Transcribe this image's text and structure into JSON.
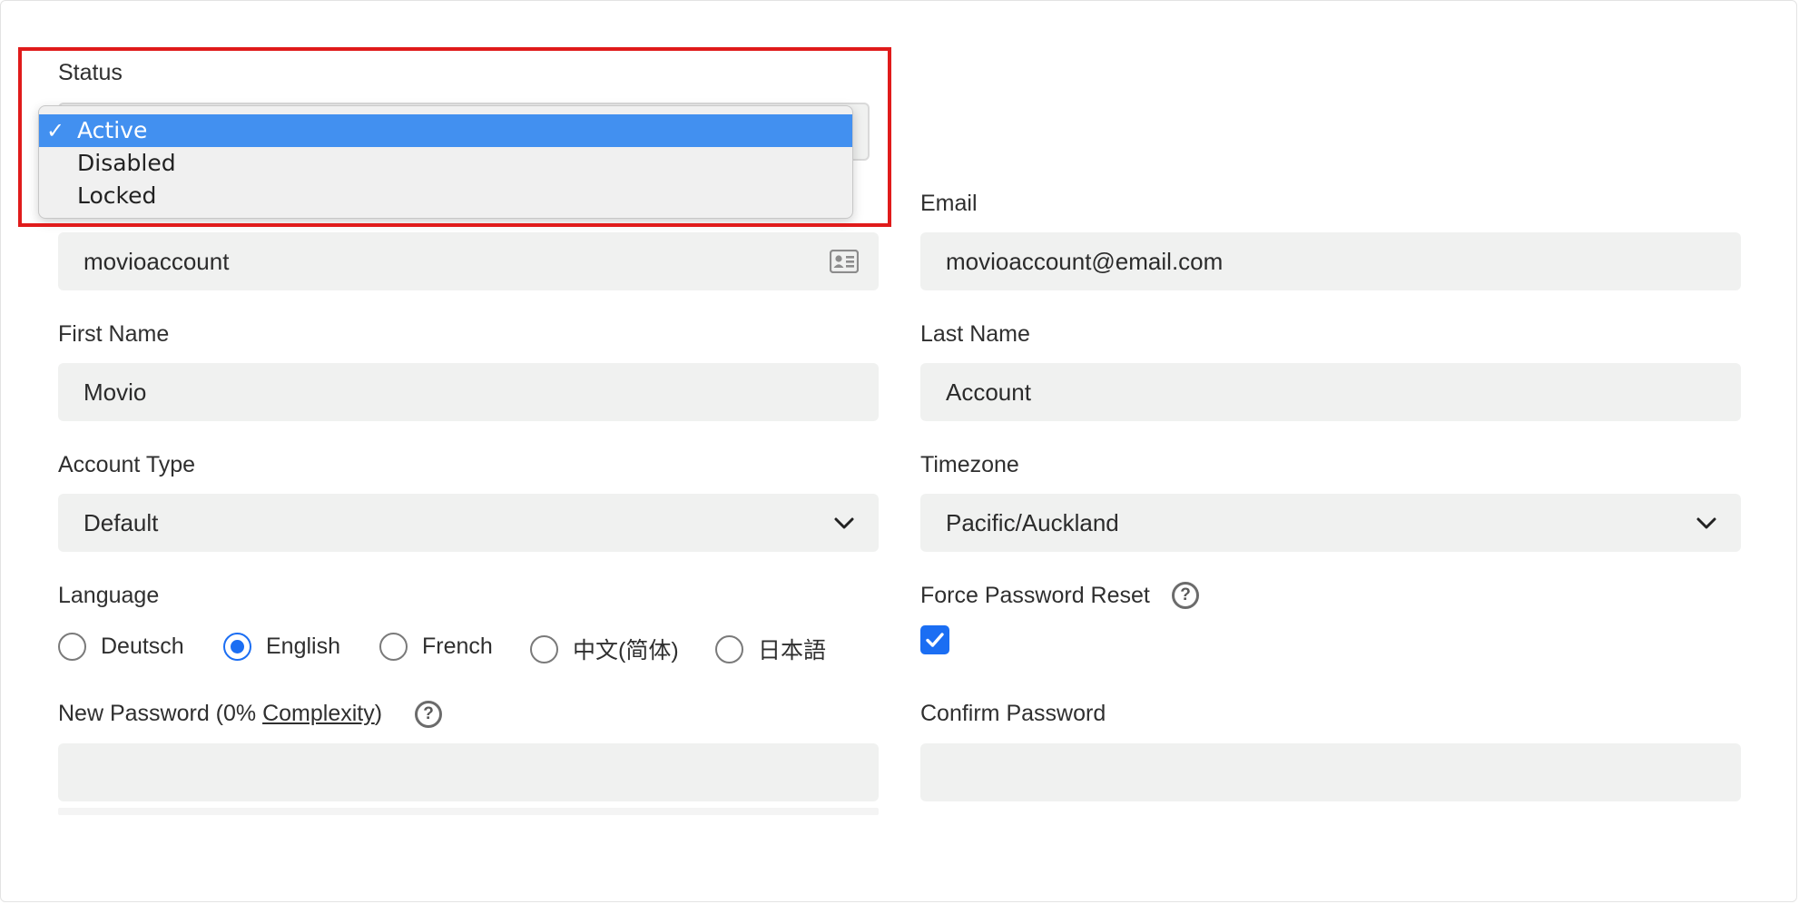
{
  "status": {
    "label": "Status",
    "options": [
      {
        "label": "Active",
        "selected": true
      },
      {
        "label": "Disabled",
        "selected": false
      },
      {
        "label": "Locked",
        "selected": false
      }
    ],
    "check_glyph": "✓"
  },
  "username": {
    "value": "movioaccount",
    "icon": "contact-card-icon"
  },
  "email": {
    "label": "Email",
    "value": "movioaccount@email.com"
  },
  "first_name": {
    "label": "First Name",
    "value": "Movio"
  },
  "last_name": {
    "label": "Last Name",
    "value": "Account"
  },
  "account_type": {
    "label": "Account Type",
    "value": "Default"
  },
  "timezone": {
    "label": "Timezone",
    "value": "Pacific/Auckland"
  },
  "language": {
    "label": "Language",
    "options": [
      {
        "label": "Deutsch",
        "checked": false
      },
      {
        "label": "English",
        "checked": true
      },
      {
        "label": "French",
        "checked": false
      },
      {
        "label": "中文(简体)",
        "checked": false
      },
      {
        "label": "日本語",
        "checked": false
      }
    ]
  },
  "force_password_reset": {
    "label": "Force Password Reset",
    "checked": true,
    "help": "?"
  },
  "new_password": {
    "label_prefix": "New Password (0% ",
    "complexity_link": "Complexity",
    "label_suffix": ")",
    "help": "?",
    "value": ""
  },
  "confirm_password": {
    "label": "Confirm Password",
    "value": ""
  },
  "colors": {
    "accent": "#1b6ef3",
    "highlight": "#e01b1b",
    "selected_option": "#4290f0",
    "field_bg": "#f0f1f0"
  }
}
